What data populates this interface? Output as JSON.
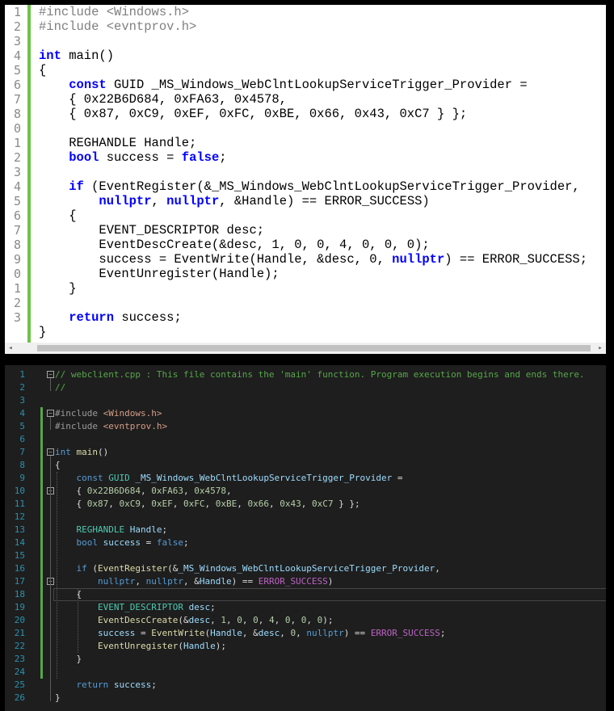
{
  "light_editor": {
    "line_numbers": [
      "1",
      "2",
      "3",
      "4",
      "5",
      "6",
      "7",
      "8",
      "0",
      "1",
      "2",
      "3",
      "4",
      "5",
      "6",
      "7",
      "8",
      "9",
      "0",
      "1",
      "2",
      "3"
    ],
    "lines": [
      [
        {
          "t": "#include <Windows.h>",
          "c": "mac"
        }
      ],
      [
        {
          "t": "#include <evntprov.h>",
          "c": "mac"
        }
      ],
      [],
      [
        {
          "t": "int",
          "c": "kw"
        },
        {
          "t": " main()"
        }
      ],
      [
        {
          "t": "{"
        }
      ],
      [
        {
          "t": "    "
        },
        {
          "t": "const",
          "c": "kw"
        },
        {
          "t": " GUID _MS_Windows_WebClntLookupServiceTrigger_Provider ="
        }
      ],
      [
        {
          "t": "    { 0x22B6D684, 0xFA63, 0x4578,"
        }
      ],
      [
        {
          "t": "    { 0x87, 0xC9, 0xEF, 0xFC, 0xBE, 0x66, 0x43, 0xC7 } };"
        }
      ],
      [],
      [
        {
          "t": "    REGHANDLE Handle;"
        }
      ],
      [
        {
          "t": "    "
        },
        {
          "t": "bool",
          "c": "kw"
        },
        {
          "t": " success = "
        },
        {
          "t": "false",
          "c": "kw"
        },
        {
          "t": ";"
        }
      ],
      [],
      [
        {
          "t": "    "
        },
        {
          "t": "if",
          "c": "kw"
        },
        {
          "t": " (EventRegister(&_MS_Windows_WebClntLookupServiceTrigger_Provider,"
        }
      ],
      [
        {
          "t": "        "
        },
        {
          "t": "nullptr",
          "c": "kw"
        },
        {
          "t": ", "
        },
        {
          "t": "nullptr",
          "c": "kw"
        },
        {
          "t": ", &Handle) == ERROR_SUCCESS)"
        }
      ],
      [
        {
          "t": "    {"
        }
      ],
      [
        {
          "t": "        EVENT_DESCRIPTOR desc;"
        }
      ],
      [
        {
          "t": "        EventDescCreate(&desc, 1, 0, 0, 4, 0, 0, 0);"
        }
      ],
      [
        {
          "t": "        success = EventWrite(Handle, &desc, 0, "
        },
        {
          "t": "nullptr",
          "c": "kw"
        },
        {
          "t": ") == ERROR_SUCCESS;"
        }
      ],
      [
        {
          "t": "        EventUnregister(Handle);"
        }
      ],
      [
        {
          "t": "    }"
        }
      ],
      [],
      [
        {
          "t": "    "
        },
        {
          "t": "return",
          "c": "kw"
        },
        {
          "t": " success;"
        }
      ],
      [
        {
          "t": "}"
        }
      ]
    ],
    "scroll_left_glyph": "◂",
    "scroll_right_glyph": "▸"
  },
  "dark_editor": {
    "line_numbers": [
      "1",
      "2",
      "3",
      "4",
      "5",
      "6",
      "7",
      "8",
      "9",
      "10",
      "11",
      "12",
      "13",
      "14",
      "15",
      "16",
      "17",
      "18",
      "19",
      "20",
      "21",
      "22",
      "23",
      "24",
      "25",
      "26"
    ],
    "lines": [
      [
        {
          "t": "// webclient.cpp : This file contains the 'main' function. Program execution begins and ends there.",
          "c": "dcm"
        }
      ],
      [
        {
          "t": "//",
          "c": "dcm"
        }
      ],
      [],
      [
        {
          "t": "#include ",
          "c": "dpp"
        },
        {
          "t": "<Windows.h>",
          "c": "dstr"
        }
      ],
      [
        {
          "t": "#include ",
          "c": "dpp"
        },
        {
          "t": "<evntprov.h>",
          "c": "dstr"
        }
      ],
      [],
      [
        {
          "t": "int",
          "c": "dk"
        },
        {
          "t": " "
        },
        {
          "t": "main",
          "c": "dfn"
        },
        {
          "t": "()"
        }
      ],
      [
        {
          "t": "{"
        }
      ],
      [
        {
          "t": "    "
        },
        {
          "t": "const",
          "c": "dk"
        },
        {
          "t": " "
        },
        {
          "t": "GUID",
          "c": "dty"
        },
        {
          "t": " "
        },
        {
          "t": "_MS_Windows_WebClntLookupServiceTrigger_Provider",
          "c": "dvar"
        },
        {
          "t": " ="
        }
      ],
      [
        {
          "t": "    { "
        },
        {
          "t": "0x22B6D684",
          "c": "dnum"
        },
        {
          "t": ", "
        },
        {
          "t": "0xFA63",
          "c": "dnum"
        },
        {
          "t": ", "
        },
        {
          "t": "0x4578",
          "c": "dnum"
        },
        {
          "t": ","
        }
      ],
      [
        {
          "t": "    { "
        },
        {
          "t": "0x87",
          "c": "dnum"
        },
        {
          "t": ", "
        },
        {
          "t": "0xC9",
          "c": "dnum"
        },
        {
          "t": ", "
        },
        {
          "t": "0xEF",
          "c": "dnum"
        },
        {
          "t": ", "
        },
        {
          "t": "0xFC",
          "c": "dnum"
        },
        {
          "t": ", "
        },
        {
          "t": "0xBE",
          "c": "dnum"
        },
        {
          "t": ", "
        },
        {
          "t": "0x66",
          "c": "dnum"
        },
        {
          "t": ", "
        },
        {
          "t": "0x43",
          "c": "dnum"
        },
        {
          "t": ", "
        },
        {
          "t": "0xC7",
          "c": "dnum"
        },
        {
          "t": " } };"
        }
      ],
      [],
      [
        {
          "t": "    "
        },
        {
          "t": "REGHANDLE",
          "c": "dty"
        },
        {
          "t": " "
        },
        {
          "t": "Handle",
          "c": "dvar"
        },
        {
          "t": ";"
        }
      ],
      [
        {
          "t": "    "
        },
        {
          "t": "bool",
          "c": "dk"
        },
        {
          "t": " "
        },
        {
          "t": "success",
          "c": "dvar"
        },
        {
          "t": " = "
        },
        {
          "t": "false",
          "c": "dk"
        },
        {
          "t": ";"
        }
      ],
      [],
      [
        {
          "t": "    "
        },
        {
          "t": "if",
          "c": "dk"
        },
        {
          "t": " ("
        },
        {
          "t": "EventRegister",
          "c": "dfn"
        },
        {
          "t": "(&"
        },
        {
          "t": "_MS_Windows_WebClntLookupServiceTrigger_Provider",
          "c": "dvar"
        },
        {
          "t": ","
        }
      ],
      [
        {
          "t": "        "
        },
        {
          "t": "nullptr",
          "c": "dk"
        },
        {
          "t": ", "
        },
        {
          "t": "nullptr",
          "c": "dk"
        },
        {
          "t": ", &"
        },
        {
          "t": "Handle",
          "c": "dvar"
        },
        {
          "t": ") == "
        },
        {
          "t": "ERROR_SUCCESS",
          "c": "dmac"
        },
        {
          "t": ")"
        }
      ],
      [
        {
          "t": "    {"
        }
      ],
      [
        {
          "t": "        "
        },
        {
          "t": "EVENT_DESCRIPTOR",
          "c": "dty"
        },
        {
          "t": " "
        },
        {
          "t": "desc",
          "c": "dvar"
        },
        {
          "t": ";"
        }
      ],
      [
        {
          "t": "        "
        },
        {
          "t": "EventDescCreate",
          "c": "dfn"
        },
        {
          "t": "(&"
        },
        {
          "t": "desc",
          "c": "dvar"
        },
        {
          "t": ", "
        },
        {
          "t": "1",
          "c": "dnum"
        },
        {
          "t": ", "
        },
        {
          "t": "0",
          "c": "dnum"
        },
        {
          "t": ", "
        },
        {
          "t": "0",
          "c": "dnum"
        },
        {
          "t": ", "
        },
        {
          "t": "4",
          "c": "dnum"
        },
        {
          "t": ", "
        },
        {
          "t": "0",
          "c": "dnum"
        },
        {
          "t": ", "
        },
        {
          "t": "0",
          "c": "dnum"
        },
        {
          "t": ", "
        },
        {
          "t": "0",
          "c": "dnum"
        },
        {
          "t": ");"
        }
      ],
      [
        {
          "t": "        "
        },
        {
          "t": "success",
          "c": "dvar"
        },
        {
          "t": " = "
        },
        {
          "t": "EventWrite",
          "c": "dfn"
        },
        {
          "t": "("
        },
        {
          "t": "Handle",
          "c": "dvar"
        },
        {
          "t": ", &"
        },
        {
          "t": "desc",
          "c": "dvar"
        },
        {
          "t": ", "
        },
        {
          "t": "0",
          "c": "dnum"
        },
        {
          "t": ", "
        },
        {
          "t": "nullptr",
          "c": "dk"
        },
        {
          "t": ") == "
        },
        {
          "t": "ERROR_SUCCESS",
          "c": "dmac"
        },
        {
          "t": ";"
        }
      ],
      [
        {
          "t": "        "
        },
        {
          "t": "EventUnregister",
          "c": "dfn"
        },
        {
          "t": "("
        },
        {
          "t": "Handle",
          "c": "dvar"
        },
        {
          "t": ");"
        }
      ],
      [
        {
          "t": "    }"
        }
      ],
      [],
      [
        {
          "t": "    "
        },
        {
          "t": "return",
          "c": "dk"
        },
        {
          "t": " "
        },
        {
          "t": "success",
          "c": "dvar"
        },
        {
          "t": ";"
        }
      ],
      [
        {
          "t": "}"
        }
      ]
    ],
    "fold_glyph": "−"
  },
  "colors": {
    "light_change_bar": "#6cc24a",
    "dark_change_bar": "#57a64a",
    "dark_line_number": "#2b91af",
    "dark_background": "#1e1e1e"
  }
}
